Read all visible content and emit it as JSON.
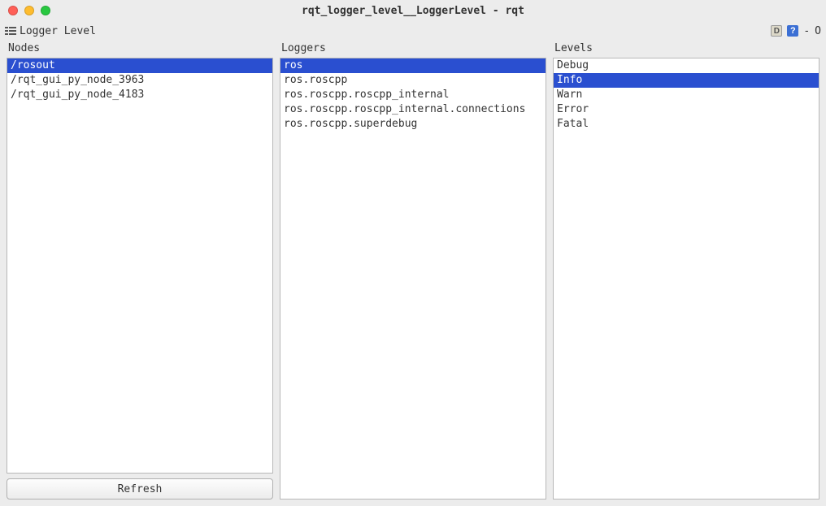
{
  "window": {
    "title": "rqt_logger_level__LoggerLevel - rqt"
  },
  "toolbar": {
    "label": "Logger Level",
    "right": {
      "dash": "-",
      "letterO": "O"
    }
  },
  "columns": {
    "nodes": {
      "header": "Nodes",
      "items": [
        {
          "label": "/rosout",
          "selected": true
        },
        {
          "label": "/rqt_gui_py_node_3963",
          "selected": false
        },
        {
          "label": "/rqt_gui_py_node_4183",
          "selected": false
        }
      ]
    },
    "loggers": {
      "header": "Loggers",
      "items": [
        {
          "label": "ros",
          "selected": true
        },
        {
          "label": "ros.roscpp",
          "selected": false
        },
        {
          "label": "ros.roscpp.roscpp_internal",
          "selected": false
        },
        {
          "label": "ros.roscpp.roscpp_internal.connections",
          "selected": false
        },
        {
          "label": "ros.roscpp.superdebug",
          "selected": false
        }
      ]
    },
    "levels": {
      "header": "Levels",
      "items": [
        {
          "label": "Debug",
          "selected": false
        },
        {
          "label": "Info",
          "selected": true
        },
        {
          "label": "Warn",
          "selected": false
        },
        {
          "label": "Error",
          "selected": false
        },
        {
          "label": "Fatal",
          "selected": false
        }
      ]
    }
  },
  "buttons": {
    "refresh": "Refresh"
  }
}
